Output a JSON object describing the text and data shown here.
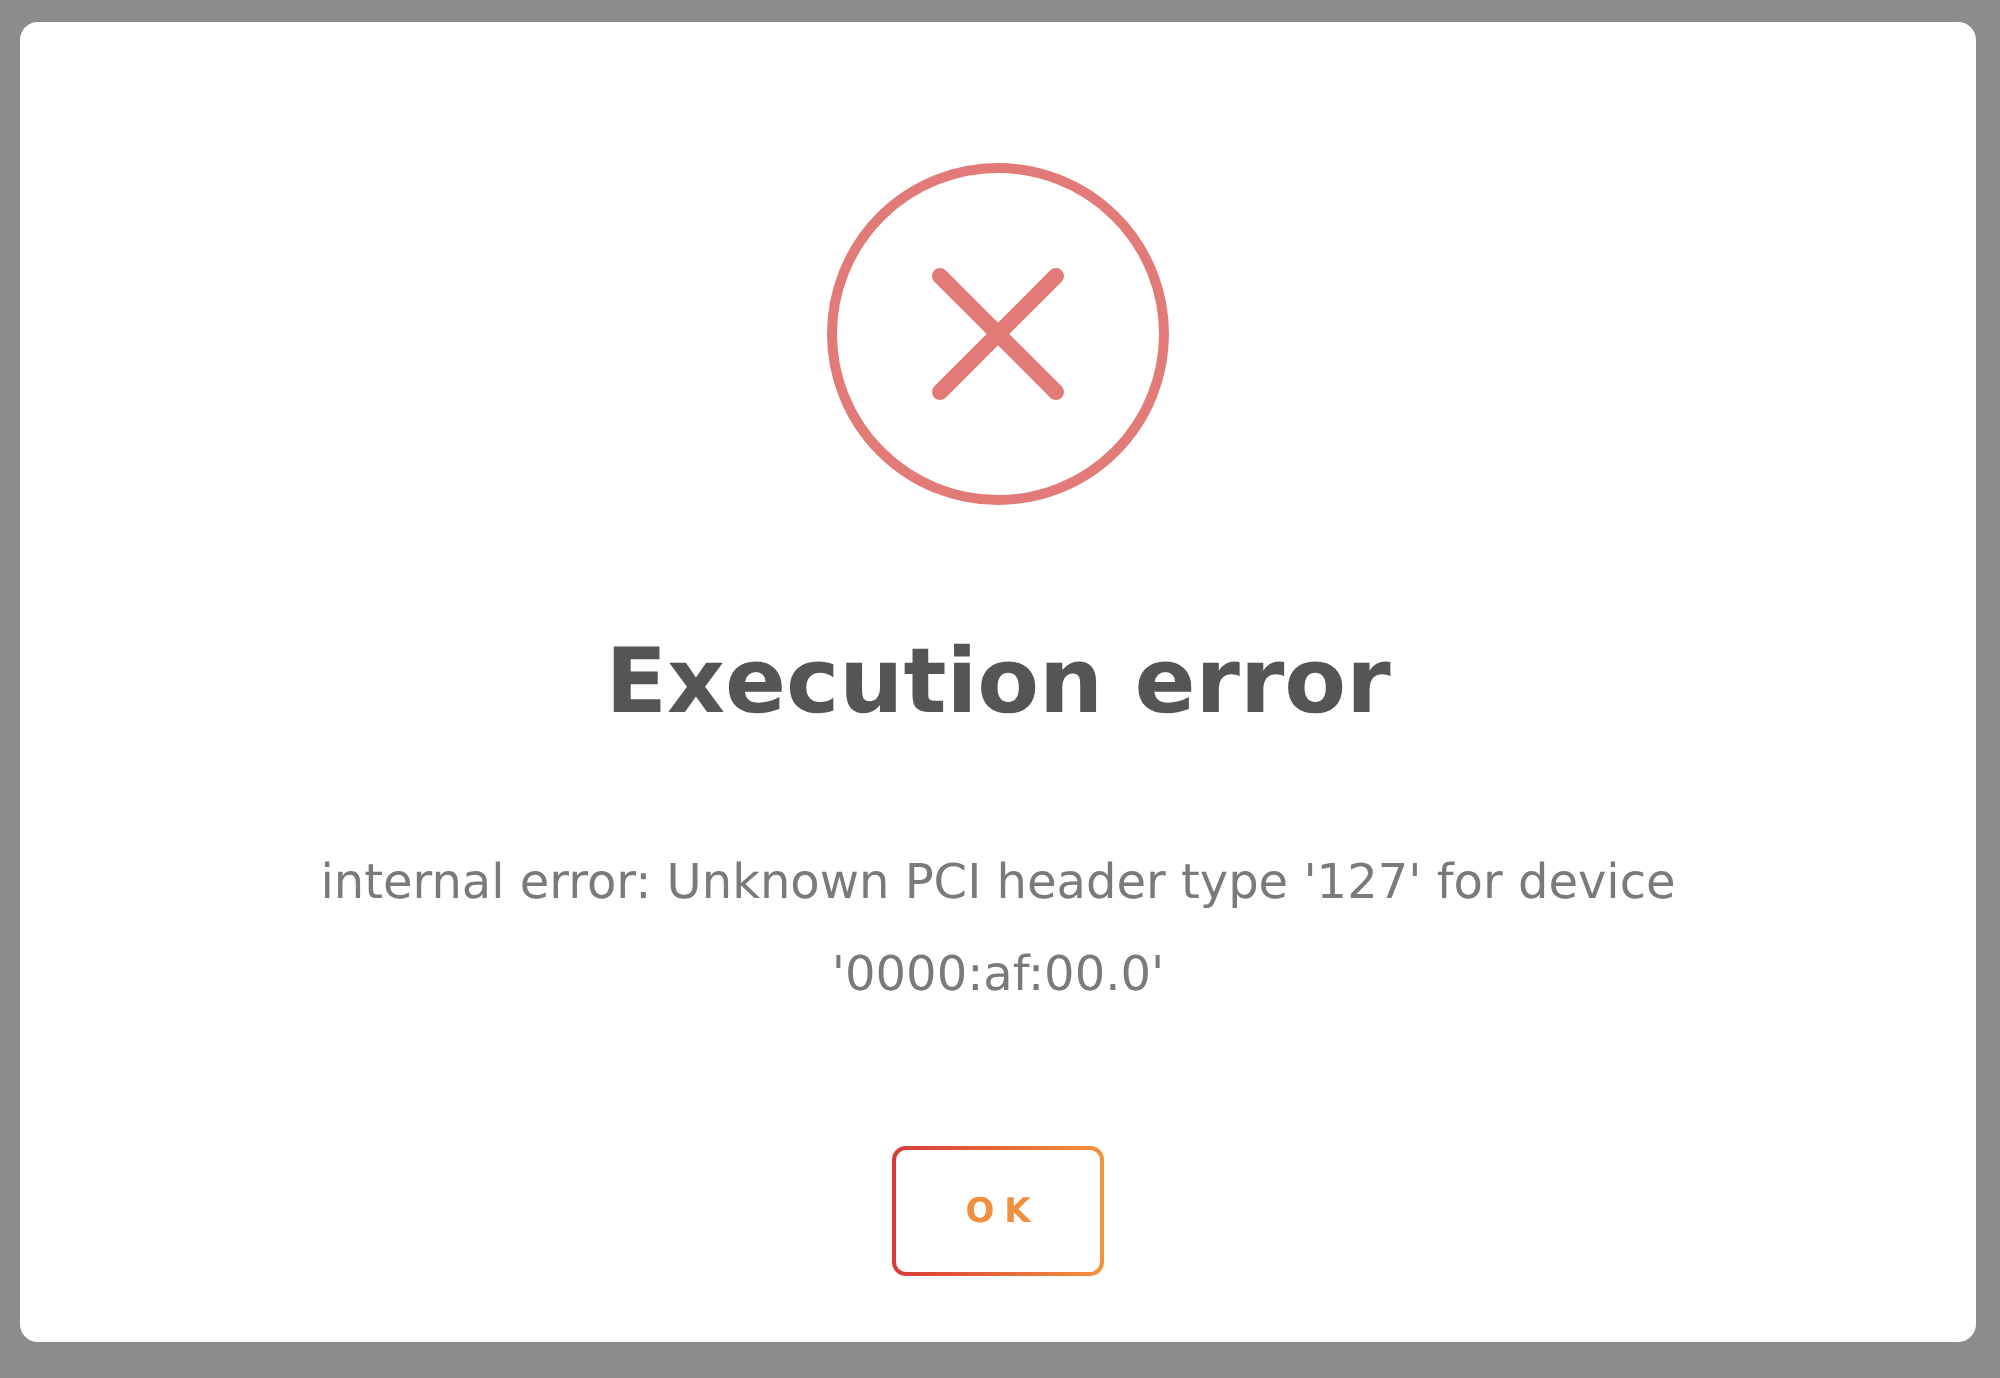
{
  "dialog": {
    "title": "Execution error",
    "message": "internal error: Unknown PCI header type '127' for device '0000:af:00.0'",
    "buttons": [
      {
        "label": "OK"
      }
    ]
  }
}
